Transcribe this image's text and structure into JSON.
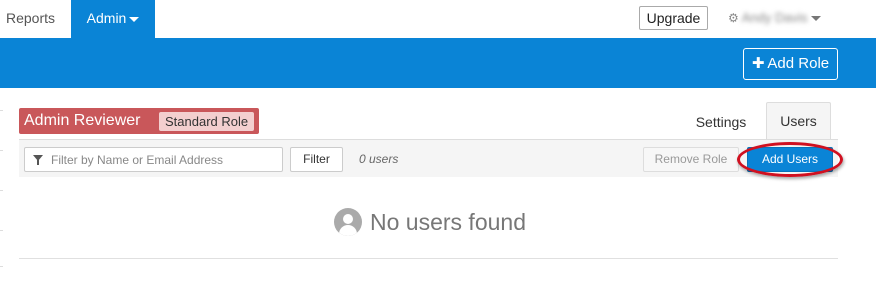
{
  "nav": {
    "reports_label": "Reports",
    "admin_label": "Admin",
    "upgrade_label": "Upgrade",
    "user_name": "Andy Davis"
  },
  "band": {
    "add_role_label": "Add Role"
  },
  "role": {
    "name": "Admin Reviewer",
    "type": "Standard Role"
  },
  "tabs": [
    {
      "label": "Settings",
      "active": false
    },
    {
      "label": "Users",
      "active": true
    }
  ],
  "toolbar": {
    "filter_placeholder": "Filter by Name or Email Address",
    "filter_value": "",
    "filter_button": "Filter",
    "user_count": "0 users",
    "remove_role_label": "Remove Role",
    "add_users_label": "Add Users"
  },
  "empty_state": {
    "message": "No users found"
  },
  "colors": {
    "brand_blue": "#0a84d6",
    "role_red": "#c9575a",
    "highlight_ring": "#d01020"
  },
  "icons": {
    "user_menu": "gear-icon",
    "add_role": "plus-icon",
    "filter": "filter-icon",
    "empty_state": "user-avatar-icon"
  }
}
